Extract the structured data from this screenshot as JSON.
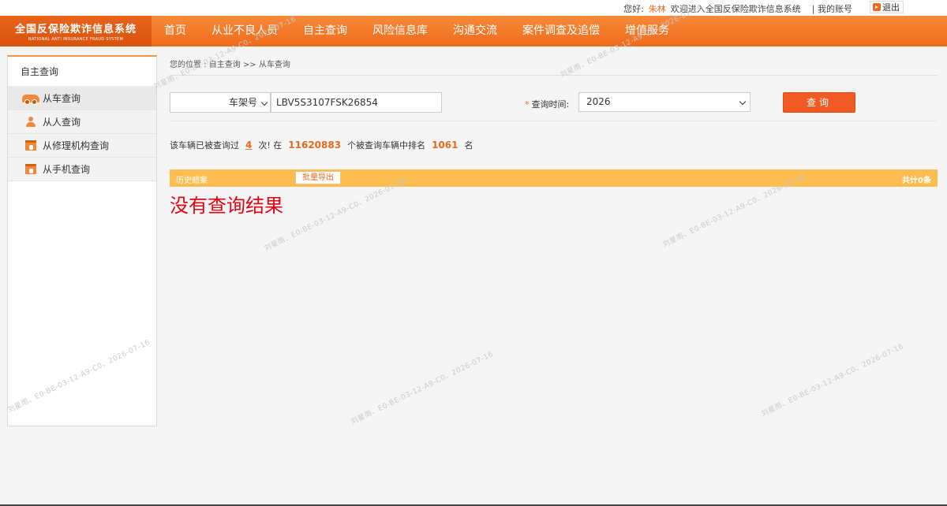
{
  "topbar": {
    "greeting": "您好:",
    "user": "朱林",
    "welcome": "欢迎进入全国反保险欺诈信息系统",
    "account": "| 我的账号",
    "logout": "退出"
  },
  "logo": {
    "title_cn": "全国反保险欺诈信息系统",
    "title_en": "NATIONAL ANTI INSURANCE FRAUD SYSTEM"
  },
  "nav": {
    "items": [
      {
        "label": "首页"
      },
      {
        "label": "从业不良人员"
      },
      {
        "label": "自主查询"
      },
      {
        "label": "风险信息库"
      },
      {
        "label": "沟通交流"
      },
      {
        "label": "案件调查及追偿"
      },
      {
        "label": "增值服务"
      }
    ]
  },
  "sidebar": {
    "title": "自主查询",
    "items": [
      {
        "label": "从车查询",
        "icon": "car-icon"
      },
      {
        "label": "从人查询",
        "icon": "person-icon"
      },
      {
        "label": "从修理机构查询",
        "icon": "repair-shop-icon"
      },
      {
        "label": "从手机查询",
        "icon": "phone-icon"
      }
    ]
  },
  "breadcrumb": "您的位置 : 自主查询 >> 从车查询",
  "query": {
    "field_type": "车架号",
    "vin": "LBV5S3107FSK26854",
    "time_required_mark": "*",
    "time_label": "查询时间:",
    "year": "2026",
    "query_button": "查询"
  },
  "stats": {
    "prefix": "该车辆已被查询过",
    "query_count": "4",
    "mid1": "次! 在",
    "total_vehicles": "11620883",
    "mid2": "个被查询车辆中排名",
    "rank": "1061",
    "suffix": "名"
  },
  "history": {
    "title": "历史赔案",
    "export_button": "批量导出",
    "total": "共计0条"
  },
  "no_result": "没有查询结果",
  "watermark": "刘星雨、E0-BE-03-12-A9-C0、2026-07-16",
  "colors": {
    "nav_orange": "#f47b2a",
    "logo_orange": "#e05d15",
    "history_bar": "#fdbd51",
    "query_button": "#f15a24",
    "no_result_red": "#e60012",
    "accent": "#e8691e"
  }
}
